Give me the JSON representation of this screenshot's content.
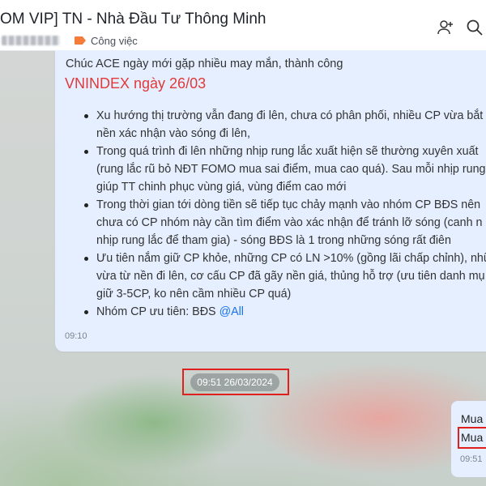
{
  "header": {
    "title": "OM VIP] TN - Nhà Đầu Tư Thông Minh",
    "category": "Công việc",
    "icons": [
      "add-member-icon",
      "search-icon"
    ]
  },
  "message": {
    "greeting": "Chúc ACE ngày mới gặp nhiều may mắn, thành công",
    "title": "VNINDEX ngày 26/03",
    "bullets": [
      {
        "line1": "Xu hướng thị trường vẫn đang đi lên, chưa có phân phối, nhiều CP vừa bắt",
        "line2": "nền xác nhận vào sóng đi lên,"
      },
      {
        "line1": "Trong quá trình đi lên những nhịp rung lắc xuất hiện sẽ thường xuyên xuất",
        "line2": "(rung lắc rũ bỏ NĐT FOMO mua sai điểm, mua cao quá). Sau mỗi nhịp rung",
        "line3": "giúp TT chinh phục vùng giá, vùng điểm cao mới"
      },
      {
        "line1": "Trong thời gian tới dòng tiền sẽ tiếp tục chảy mạnh vào nhóm CP BĐS nên",
        "line2": "chưa có CP nhóm này cần tìm điểm vào xác nhận để tránh lỡ sóng (canh n",
        "line3": "nhịp rung lắc để tham gia) - sóng BĐS là 1 trong những sóng rất điên"
      },
      {
        "line1": "Ưu tiên nắm giữ CP khỏe, những CP có LN >10% (gồng lãi chấp chỉnh), nhữ",
        "line2": "vừa từ nền đi lên, cơ cấu CP đã gãy nền giá, thủng hỗ trợ (ưu tiên danh mụ",
        "line3": "giữ 3-5CP, ko nên cầm nhiều CP quá)"
      },
      {
        "line1": "Nhóm CP ưu tiên: BĐS",
        "mention": "@All"
      }
    ],
    "time": "09:10"
  },
  "date_separator": "09:51 26/03/2024",
  "outgoing": {
    "line1": "Mua",
    "line2": "Mua",
    "time": "09:51"
  },
  "colors": {
    "accent_red": "#e03a3a",
    "mention_blue": "#1a73e8",
    "bubble_bg": "#e5efff",
    "highlight_box": "#e01f1f",
    "tag_orange": "#f57c3a"
  }
}
